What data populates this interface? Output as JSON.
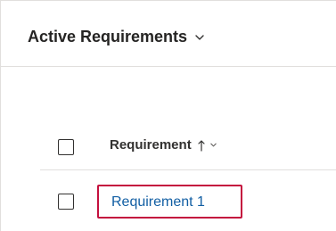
{
  "view": {
    "title": "Active Requirements",
    "switcher_icon": "chevron-down-icon"
  },
  "grid": {
    "columns": [
      {
        "label": "Requirement",
        "sort": "ascending",
        "sort_icon": "sort-ascending-arrow-icon",
        "menu_icon": "chevron-down-icon"
      }
    ],
    "rows": [
      {
        "requirement": "Requirement 1",
        "highlighted": true
      }
    ]
  },
  "colors": {
    "link": "#115ea3",
    "highlight_border": "#c4103e",
    "divider": "#e1dfdd",
    "text": "#323130"
  }
}
